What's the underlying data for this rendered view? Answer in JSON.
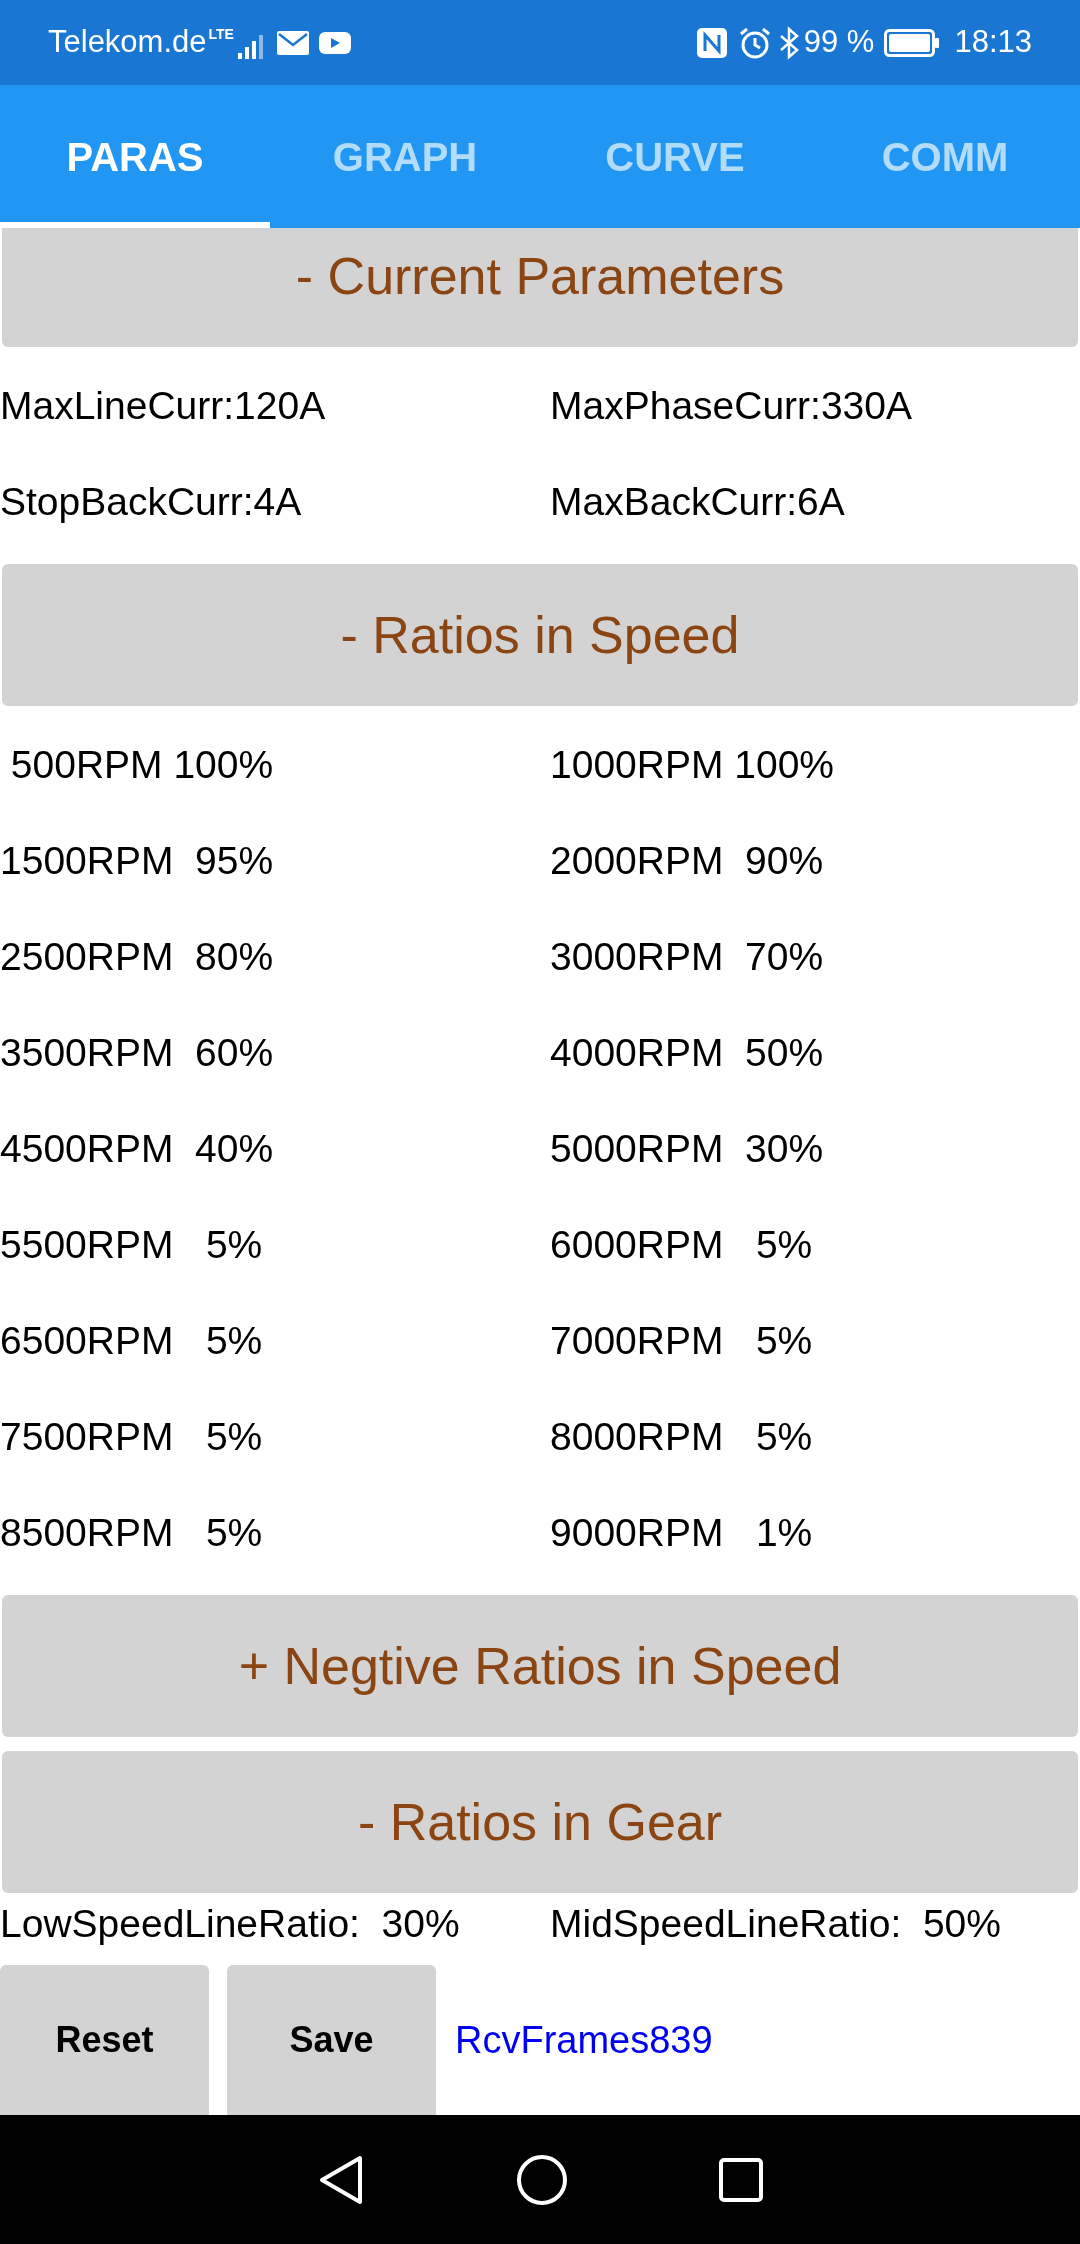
{
  "status_bar": {
    "carrier": "Telekom.de",
    "network": "LTE",
    "battery": "99 %",
    "time": "18:13"
  },
  "tabs": [
    {
      "label": "PARAS",
      "selected": true
    },
    {
      "label": "GRAPH",
      "selected": false
    },
    {
      "label": "CURVE",
      "selected": false
    },
    {
      "label": "COMM",
      "selected": false
    }
  ],
  "sections": [
    {
      "header": "- Current Parameters",
      "rows": [
        [
          "MaxLineCurr:120A",
          "MaxPhaseCurr:330A"
        ],
        [
          "StopBackCurr:4A",
          "MaxBackCurr:6A"
        ]
      ]
    },
    {
      "header": "- Ratios in Speed",
      "rows": [
        [
          " 500RPM 100%",
          "1000RPM 100%"
        ],
        [
          "1500RPM  95%",
          "2000RPM  90%"
        ],
        [
          "2500RPM  80%",
          "3000RPM  70%"
        ],
        [
          "3500RPM  60%",
          "4000RPM  50%"
        ],
        [
          "4500RPM  40%",
          "5000RPM  30%"
        ],
        [
          "5500RPM   5%",
          "6000RPM   5%"
        ],
        [
          "6500RPM   5%",
          "7000RPM   5%"
        ],
        [
          "7500RPM   5%",
          "8000RPM   5%"
        ],
        [
          "8500RPM   5%",
          "9000RPM   1%"
        ]
      ]
    },
    {
      "header": "+ Negtive Ratios in Speed"
    },
    {
      "header": "- Ratios in Gear",
      "rows": [
        [
          "LowSpeedLineRatio:  30%",
          "MidSpeedLineRatio:  50%"
        ]
      ]
    }
  ],
  "buttons": [
    "Reset",
    "Save"
  ],
  "frames_label": "RcvFrames839"
}
